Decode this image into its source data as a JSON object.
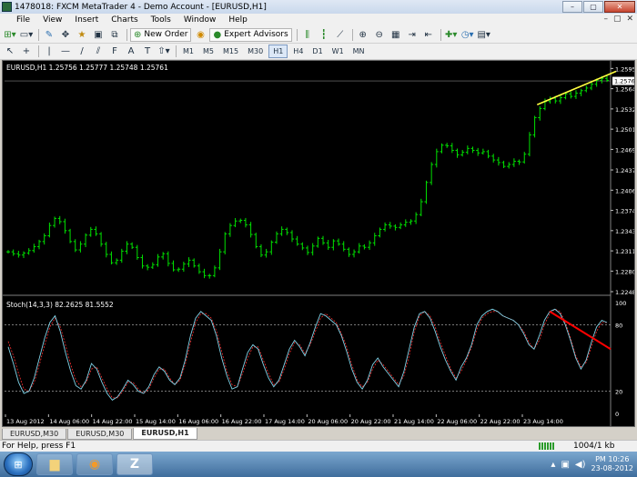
{
  "window": {
    "title": "1478018: FXCM MetaTrader 4 - Demo Account - [EURUSD,H1]",
    "controls": {
      "minimize": "–",
      "maximize": "▢",
      "close": "✕"
    }
  },
  "menu": {
    "items": [
      "File",
      "View",
      "Insert",
      "Charts",
      "Tools",
      "Window",
      "Help"
    ],
    "mdi": {
      "minimize": "–",
      "restore": "▢",
      "close": "✕"
    }
  },
  "toolbar": {
    "new_order_label": "New Order",
    "expert_advisors_label": "Expert Advisors",
    "timeframes": [
      "M1",
      "M5",
      "M15",
      "M30",
      "H1",
      "H4",
      "D1",
      "W1",
      "MN"
    ],
    "active_timeframe": "H1",
    "draw_tools": {
      "cursor": "↖",
      "crosshair": "+",
      "vline": "|",
      "hline": "—",
      "trend": "/",
      "channel": "⫽",
      "fib": "F",
      "text": "A",
      "label": "T"
    }
  },
  "chart": {
    "symbol_header": "EURUSD,H1  1.25756 1.25777 1.25748 1.25761",
    "current_price": "1.25761",
    "price_ticks": [
      "1.25955",
      "1.25640",
      "1.25325",
      "1.25010",
      "1.24695",
      "1.24375",
      "1.24060",
      "1.23745",
      "1.23430",
      "1.23115",
      "1.22800",
      "1.22480"
    ],
    "price_range": [
      1.2248,
      1.2596
    ],
    "indicator_header": "Stoch(14,3,3) 82.2625 81.5552",
    "stoch_ticks": [
      "100",
      "80",
      "20",
      "0"
    ],
    "stoch_levels": [
      80,
      20
    ],
    "time_ticks": [
      "13 Aug 2012",
      "14 Aug 06:00",
      "14 Aug 22:00",
      "15 Aug 14:00",
      "16 Aug 06:00",
      "16 Aug 22:00",
      "17 Aug 14:00",
      "20 Aug 06:00",
      "20 Aug 22:00",
      "21 Aug 14:00",
      "22 Aug 06:00",
      "22 Aug 22:00",
      "23 Aug 14:00"
    ],
    "colors": {
      "background": "#000000",
      "bars": "#00e000",
      "stoch_main": "#7fd3e8",
      "stoch_signal": "#ff3030",
      "price_trendline": "#ffff40",
      "stoch_trendline": "#ff0000",
      "text": "#ffffff",
      "grid_level": "#a0a0a0"
    },
    "price_series": [
      1.231,
      1.2307,
      1.2305,
      1.2308,
      1.2312,
      1.2318,
      1.2326,
      1.2335,
      1.2351,
      1.2362,
      1.2357,
      1.2343,
      1.2326,
      1.2313,
      1.2322,
      1.2336,
      1.2345,
      1.2338,
      1.2322,
      1.2306,
      1.2293,
      1.2297,
      1.2311,
      1.2322,
      1.2317,
      1.2301,
      1.2288,
      1.2286,
      1.229,
      1.2302,
      1.2307,
      1.2292,
      1.2282,
      1.2283,
      1.2291,
      1.2297,
      1.2288,
      1.2279,
      1.2273,
      1.2273,
      1.2285,
      1.231,
      1.2338,
      1.2351,
      1.2358,
      1.2359,
      1.2352,
      1.2337,
      1.2318,
      1.2305,
      1.231,
      1.2325,
      1.2338,
      1.2345,
      1.234,
      1.233,
      1.2322,
      1.2316,
      1.2309,
      1.2319,
      1.2331,
      1.2324,
      1.2317,
      1.2327,
      1.2322,
      1.2314,
      1.2306,
      1.231,
      1.2319,
      1.2317,
      1.2324,
      1.2335,
      1.2345,
      1.2352,
      1.235,
      1.2348,
      1.2352,
      1.2356,
      1.2358,
      1.2368,
      1.2388,
      1.2418,
      1.2446,
      1.2466,
      1.2476,
      1.2475,
      1.2468,
      1.2461,
      1.2465,
      1.2471,
      1.2468,
      1.2464,
      1.2466,
      1.2459,
      1.2453,
      1.2449,
      1.2443,
      1.2446,
      1.2451,
      1.245,
      1.2462,
      1.2492,
      1.2519,
      1.2533,
      1.2544,
      1.2549,
      1.2545,
      1.255,
      1.2556,
      1.2552,
      1.2557,
      1.2561,
      1.2565,
      1.2571,
      1.2577,
      1.258,
      1.2577
    ],
    "stoch_main": [
      60,
      45,
      28,
      18,
      20,
      32,
      50,
      68,
      82,
      88,
      74,
      55,
      38,
      25,
      22,
      30,
      45,
      40,
      28,
      18,
      12,
      15,
      22,
      30,
      26,
      20,
      18,
      24,
      35,
      42,
      38,
      30,
      26,
      32,
      48,
      70,
      86,
      92,
      88,
      84,
      70,
      50,
      34,
      22,
      24,
      40,
      55,
      62,
      58,
      44,
      32,
      24,
      30,
      44,
      58,
      66,
      60,
      52,
      64,
      78,
      90,
      88,
      84,
      80,
      70,
      56,
      40,
      28,
      22,
      30,
      44,
      50,
      42,
      36,
      30,
      24,
      38,
      58,
      78,
      90,
      92,
      86,
      74,
      60,
      48,
      38,
      30,
      42,
      50,
      62,
      80,
      88,
      92,
      94,
      92,
      88,
      86,
      84,
      80,
      72,
      62,
      58,
      70,
      84,
      92,
      94,
      90,
      80,
      66,
      50,
      40,
      48,
      64,
      78,
      84,
      82
    ],
    "stoch_signal": [
      65,
      52,
      36,
      22,
      20,
      28,
      44,
      62,
      78,
      86,
      78,
      62,
      44,
      30,
      24,
      28,
      40,
      42,
      32,
      22,
      14,
      14,
      20,
      28,
      28,
      22,
      18,
      22,
      32,
      40,
      40,
      32,
      26,
      30,
      44,
      64,
      82,
      90,
      90,
      86,
      74,
      56,
      38,
      26,
      24,
      36,
      50,
      60,
      60,
      48,
      36,
      26,
      28,
      40,
      54,
      64,
      62,
      54,
      62,
      74,
      86,
      90,
      86,
      82,
      72,
      60,
      44,
      30,
      24,
      28,
      40,
      48,
      44,
      38,
      32,
      26,
      34,
      52,
      74,
      88,
      92,
      88,
      78,
      64,
      52,
      40,
      32,
      38,
      48,
      60,
      76,
      86,
      90,
      92,
      92,
      88,
      86,
      84,
      80,
      74,
      64,
      58,
      66,
      80,
      90,
      94,
      92,
      82,
      68,
      52,
      42,
      46,
      60,
      74,
      82,
      82
    ]
  },
  "tabs": {
    "items": [
      "EURUSD,M30",
      "EURUSD,M30",
      "EURUSD,H1"
    ],
    "active": 2
  },
  "status": {
    "help": "For Help, press F1",
    "traffic": "1004/1 kb"
  },
  "taskbar": {
    "clock_time": "PM 10:26",
    "clock_date": "23-08-2012",
    "start": "⊞"
  }
}
